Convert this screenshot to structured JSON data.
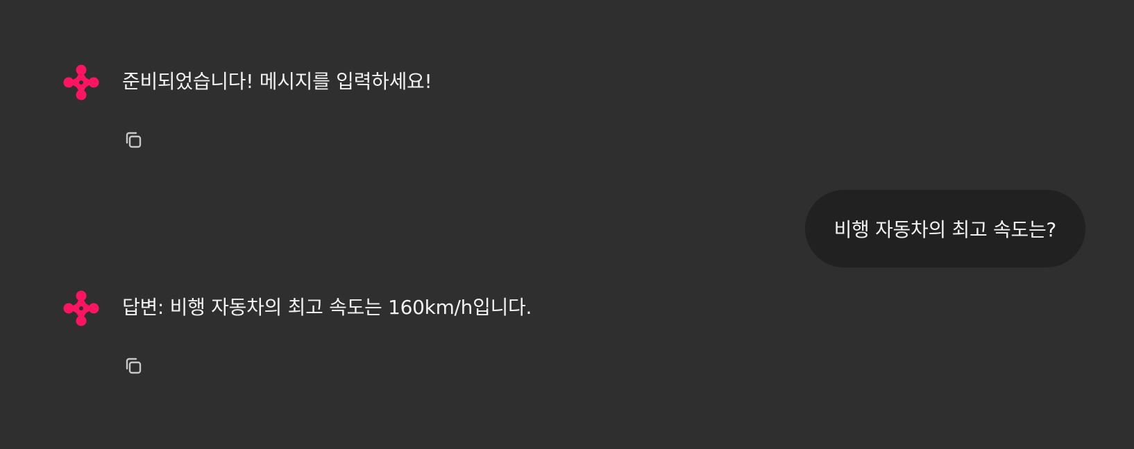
{
  "colors": {
    "background": "#2f2f2f",
    "user_bubble": "#212121",
    "accent": "#ff1464",
    "text": "#f2f2f2",
    "icon": "#c8c8c8"
  },
  "messages": [
    {
      "role": "assistant",
      "avatar_icon": "pink-clover-logo-icon",
      "text": "준비되었습니다! 메시지를 입력하세요!",
      "actions": [
        "copy-icon"
      ]
    },
    {
      "role": "user",
      "text": "비행 자동차의 최고 속도는?"
    },
    {
      "role": "assistant",
      "avatar_icon": "pink-clover-logo-icon",
      "text": "답변: 비행 자동차의 최고 속도는 160km/h입니다.",
      "actions": [
        "copy-icon"
      ]
    }
  ]
}
